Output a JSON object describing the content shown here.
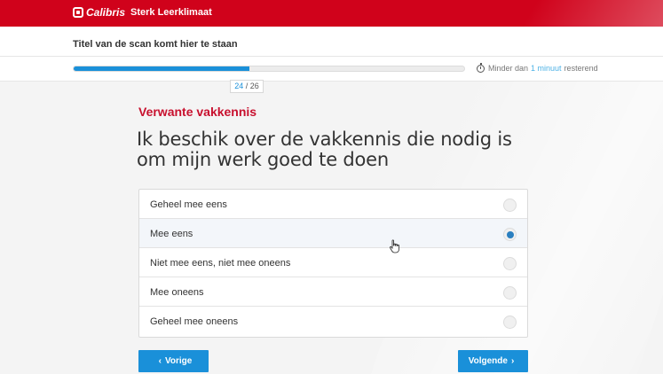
{
  "header": {
    "brand_name": "Calibris",
    "brand_sub": "Sterk Leerklimaat",
    "brand_color": "#d0021b"
  },
  "scan": {
    "title": "Titel van de scan komt hier te staan"
  },
  "progress": {
    "fraction": 0.45,
    "current": "24",
    "separator": " / ",
    "total": "26",
    "timer_before": "Minder dan",
    "timer_highlight": "1 minuut",
    "timer_after": "resterend",
    "accent": "#1a90d9"
  },
  "question": {
    "section": "Verwante vakkennis",
    "text": "Ik beschik over de vakkennis die nodig is om mijn werk goed te doen"
  },
  "options": [
    {
      "label": "Geheel mee eens",
      "selected": false
    },
    {
      "label": "Mee eens",
      "selected": true
    },
    {
      "label": "Niet mee eens, niet mee oneens",
      "selected": false
    },
    {
      "label": "Mee oneens",
      "selected": false
    },
    {
      "label": "Geheel mee oneens",
      "selected": false
    }
  ],
  "nav": {
    "prev_label": "Vorige",
    "next_label": "Volgende",
    "prev_icon": "chevron-left-icon",
    "next_icon": "chevron-right-icon"
  }
}
